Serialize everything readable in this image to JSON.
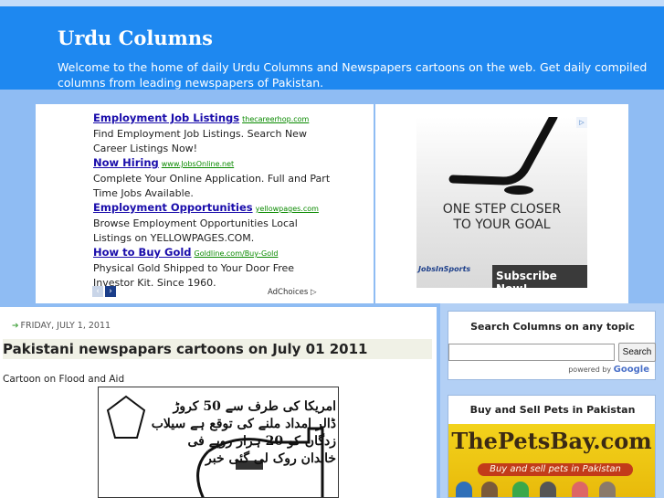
{
  "header": {
    "title": "Urdu Columns",
    "description": "Welcome to the home of daily Urdu Columns and Newspapers cartoons on the web. Get daily compiled columns from leading newspapers of Pakistan."
  },
  "ads": [
    {
      "headline": "Employment Job Listings",
      "url": "thecareerhop.com",
      "desc": "Find Employment Job Listings. Search New Career Listings Now!"
    },
    {
      "headline": "Now Hiring",
      "url": "www.JobsOnline.net",
      "desc": "Complete Your Online Application. Full and Part Time Jobs Available."
    },
    {
      "headline": "Employment Opportunities",
      "url": "yellowpages.com",
      "desc": "Browse Employment Opportunities Local Listings on YELLOWPAGES.COM."
    },
    {
      "headline": "How to Buy Gold",
      "url": "Goldline.com/Buy-Gold",
      "desc": "Physical Gold Shipped to Your Door Free Investor Kit. Since 1960."
    }
  ],
  "ad_nav": {
    "prev": "‹",
    "next": "›",
    "adchoices": "AdChoices ▷"
  },
  "banner": {
    "corner": "▷",
    "line1": "ONE STEP CLOSER",
    "line2": "TO YOUR GOAL",
    "logo": "JobsInSports",
    "subscribe": "Subscribe Now!"
  },
  "post": {
    "date": "FRIDAY, JULY 1, 2011",
    "title": "Pakistani newspapars cartoons on July 01 2011",
    "subtitle": "Cartoon on Flood and Aid",
    "cartoon_text": "امریکا کی طرف سے 50 کروڑ ڈالر امداد ملنے کی توقع ہے سیلاب زدگان کو 20 ہزار روپے فی خاندان روک لی گئی خبر"
  },
  "search_widget": {
    "title": "Search Columns on any topic",
    "button": "Search",
    "powered_by": "powered by",
    "google": "Google"
  },
  "pets_widget": {
    "title": "Buy and Sell Pets in Pakistan",
    "logo": "ThePetsBay.com",
    "tagline": "Buy and sell pets in Pakistan"
  },
  "colors": {
    "header_bg": "#1e88f0",
    "page_bg": "#8fbcf3",
    "ad_link": "#1a0dab",
    "ad_url": "#0a8a00"
  }
}
